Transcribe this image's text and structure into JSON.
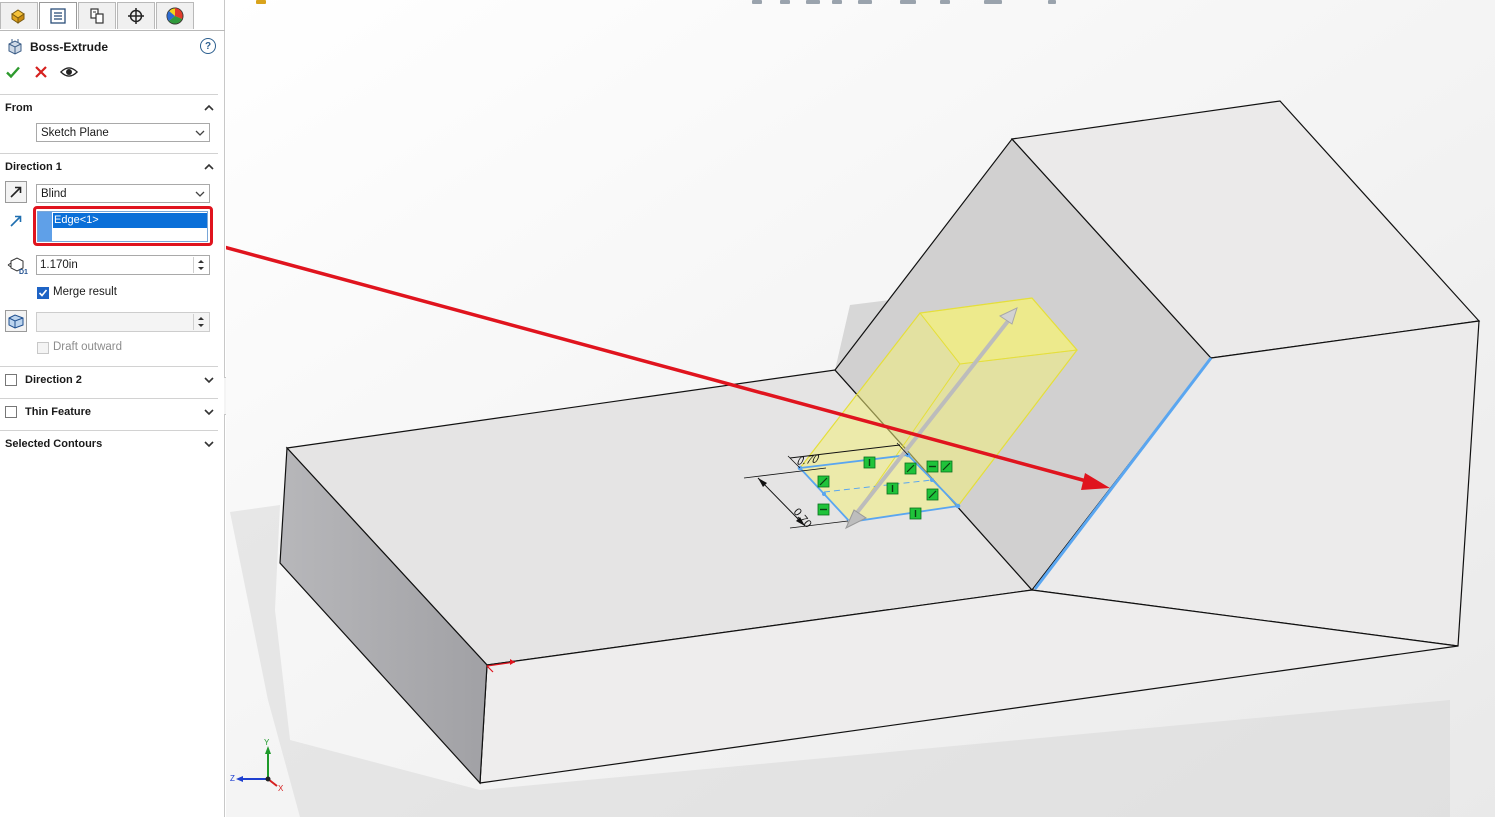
{
  "panel": {
    "title": "Boss-Extrude",
    "help_label": "?",
    "sections": {
      "from": {
        "label": "From",
        "value": "Sketch Plane"
      },
      "direction1": {
        "label": "Direction 1",
        "end_condition": "Blind",
        "direction_ref": "Edge<1>",
        "depth": "1.170in",
        "merge_result_label": "Merge result",
        "merge_result_checked": true,
        "draft_value": "",
        "draft_outward_label": "Draft outward",
        "draft_outward_checked": false
      },
      "direction2": {
        "label": "Direction 2",
        "checked": false
      },
      "thin_feature": {
        "label": "Thin Feature",
        "checked": false
      },
      "selected_contours": {
        "label": "Selected Contours"
      }
    }
  },
  "viewport": {
    "dimensions": {
      "width_dim": "0.70",
      "depth_dim": "0.70"
    },
    "axes": {
      "x": "X",
      "y": "Y",
      "z": "Z"
    }
  },
  "colors": {
    "highlight_red": "#e0141e",
    "selection_blue": "#0a6fd8",
    "edge_blue": "#5aa6f0",
    "preview_yellow": "#f2ef7a",
    "relation_green": "#1fc33a"
  }
}
